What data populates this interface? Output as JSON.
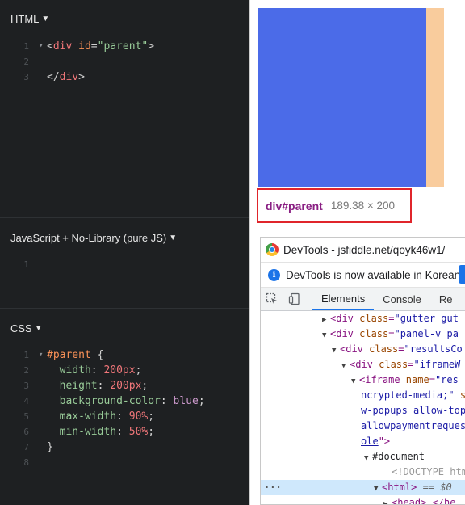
{
  "editor": {
    "html_panel": {
      "title": "HTML",
      "lines": [
        {
          "num": "1",
          "fold": "▾",
          "parts": [
            [
              "punc",
              "<"
            ],
            [
              "tag",
              "div"
            ],
            [
              "punc",
              " "
            ],
            [
              "attr",
              "id"
            ],
            [
              "punc",
              "="
            ],
            [
              "str",
              "\"parent\""
            ],
            [
              "punc",
              ">"
            ]
          ]
        },
        {
          "num": "2",
          "fold": "",
          "parts": []
        },
        {
          "num": "3",
          "fold": "",
          "parts": [
            [
              "punc",
              "</"
            ],
            [
              "tag",
              "div"
            ],
            [
              "punc",
              ">"
            ]
          ]
        }
      ]
    },
    "js_panel": {
      "title": "JavaScript + No-Library (pure JS)",
      "lines": [
        {
          "num": "1",
          "fold": "",
          "parts": []
        }
      ]
    },
    "css_panel": {
      "title": "CSS",
      "lines": [
        {
          "num": "1",
          "fold": "▾",
          "parts": [
            [
              "sel",
              "#parent"
            ],
            [
              "punc",
              " {"
            ]
          ]
        },
        {
          "num": "2",
          "fold": "",
          "parts": [
            [
              "punc",
              "  "
            ],
            [
              "prop",
              "width"
            ],
            [
              "punc",
              ": "
            ],
            [
              "num",
              "200px"
            ],
            [
              "punc",
              ";"
            ]
          ]
        },
        {
          "num": "3",
          "fold": "",
          "parts": [
            [
              "punc",
              "  "
            ],
            [
              "prop",
              "height"
            ],
            [
              "punc",
              ": "
            ],
            [
              "num",
              "200px"
            ],
            [
              "punc",
              ";"
            ]
          ]
        },
        {
          "num": "4",
          "fold": "",
          "parts": [
            [
              "punc",
              "  "
            ],
            [
              "prop",
              "background-color"
            ],
            [
              "punc",
              ": "
            ],
            [
              "kw",
              "blue"
            ],
            [
              "punc",
              ";"
            ]
          ]
        },
        {
          "num": "5",
          "fold": "",
          "parts": [
            [
              "punc",
              "  "
            ],
            [
              "prop",
              "max-width"
            ],
            [
              "punc",
              ": "
            ],
            [
              "num",
              "90%"
            ],
            [
              "punc",
              ";"
            ]
          ]
        },
        {
          "num": "6",
          "fold": "",
          "parts": [
            [
              "punc",
              "  "
            ],
            [
              "prop",
              "min-width"
            ],
            [
              "punc",
              ": "
            ],
            [
              "num",
              "50%"
            ],
            [
              "punc",
              ";"
            ]
          ]
        },
        {
          "num": "7",
          "fold": "",
          "parts": [
            [
              "punc",
              "}"
            ]
          ]
        },
        {
          "num": "8",
          "fold": "",
          "parts": []
        }
      ]
    }
  },
  "result": {
    "tooltip": {
      "selector": "div#parent",
      "size": "189.38 × 200"
    },
    "colors": {
      "box": "#4b6be8",
      "margin": "#f9cc9d",
      "highlight_border": "#e0252b"
    }
  },
  "devtools": {
    "title": "DevTools - jsfiddle.net/qoyk46w1/",
    "info": "DevTools is now available in Korean!",
    "tabs": [
      "Elements",
      "Console",
      "Re"
    ],
    "active_tab": "Elements",
    "dom_lines": [
      {
        "indent": 84,
        "tri": "▶",
        "parts": [
          [
            "tag",
            "<div "
          ],
          [
            "attr",
            "class"
          ],
          [
            "tag",
            "="
          ],
          [
            "val",
            "\"gutter gut"
          ]
        ]
      },
      {
        "indent": 84,
        "tri": "▼",
        "parts": [
          [
            "tag",
            "<div "
          ],
          [
            "attr",
            "class"
          ],
          [
            "tag",
            "="
          ],
          [
            "val",
            "\"panel-v pa"
          ]
        ]
      },
      {
        "indent": 96,
        "tri": "▼",
        "parts": [
          [
            "tag",
            "<div "
          ],
          [
            "attr",
            "class"
          ],
          [
            "tag",
            "="
          ],
          [
            "val",
            "\"resultsCo"
          ]
        ]
      },
      {
        "indent": 108,
        "tri": "▼",
        "parts": [
          [
            "tag",
            "<div "
          ],
          [
            "attr",
            "class"
          ],
          [
            "tag",
            "="
          ],
          [
            "val",
            "\"iframeW"
          ]
        ]
      },
      {
        "indent": 120,
        "tri": "▼",
        "parts": [
          [
            "tag",
            "<iframe "
          ],
          [
            "attr",
            "name"
          ],
          [
            "tag",
            "="
          ],
          [
            "val",
            "\"res"
          ]
        ]
      },
      {
        "indent": 122,
        "tri": "",
        "parts": [
          [
            "val",
            "ncrypted-media;\""
          ],
          [
            "attr",
            " s"
          ]
        ]
      },
      {
        "indent": 122,
        "tri": "",
        "parts": [
          [
            "val",
            "w-popups allow-top"
          ]
        ]
      },
      {
        "indent": 122,
        "tri": "",
        "parts": [
          [
            "val",
            "allowpaymentreques"
          ]
        ]
      },
      {
        "indent": 122,
        "tri": "",
        "parts": [
          [
            "link",
            "ole"
          ],
          [
            "tag",
            "\">"
          ]
        ]
      },
      {
        "indent": 136,
        "tri": "▼",
        "parts": [
          [
            "plain",
            "#document"
          ]
        ]
      },
      {
        "indent": 160,
        "tri": "",
        "parts": [
          [
            "com",
            "<!DOCTYPE htm"
          ]
        ]
      },
      {
        "indent": 148,
        "tri": "▼",
        "parts": [
          [
            "tag",
            "<html>"
          ],
          [
            "eq",
            " == $0"
          ]
        ],
        "highlight": true
      },
      {
        "indent": 160,
        "tri": "▶",
        "parts": [
          [
            "tag",
            "<head>"
          ],
          [
            "plain",
            "…"
          ],
          [
            "tag",
            "</he"
          ]
        ]
      }
    ]
  }
}
